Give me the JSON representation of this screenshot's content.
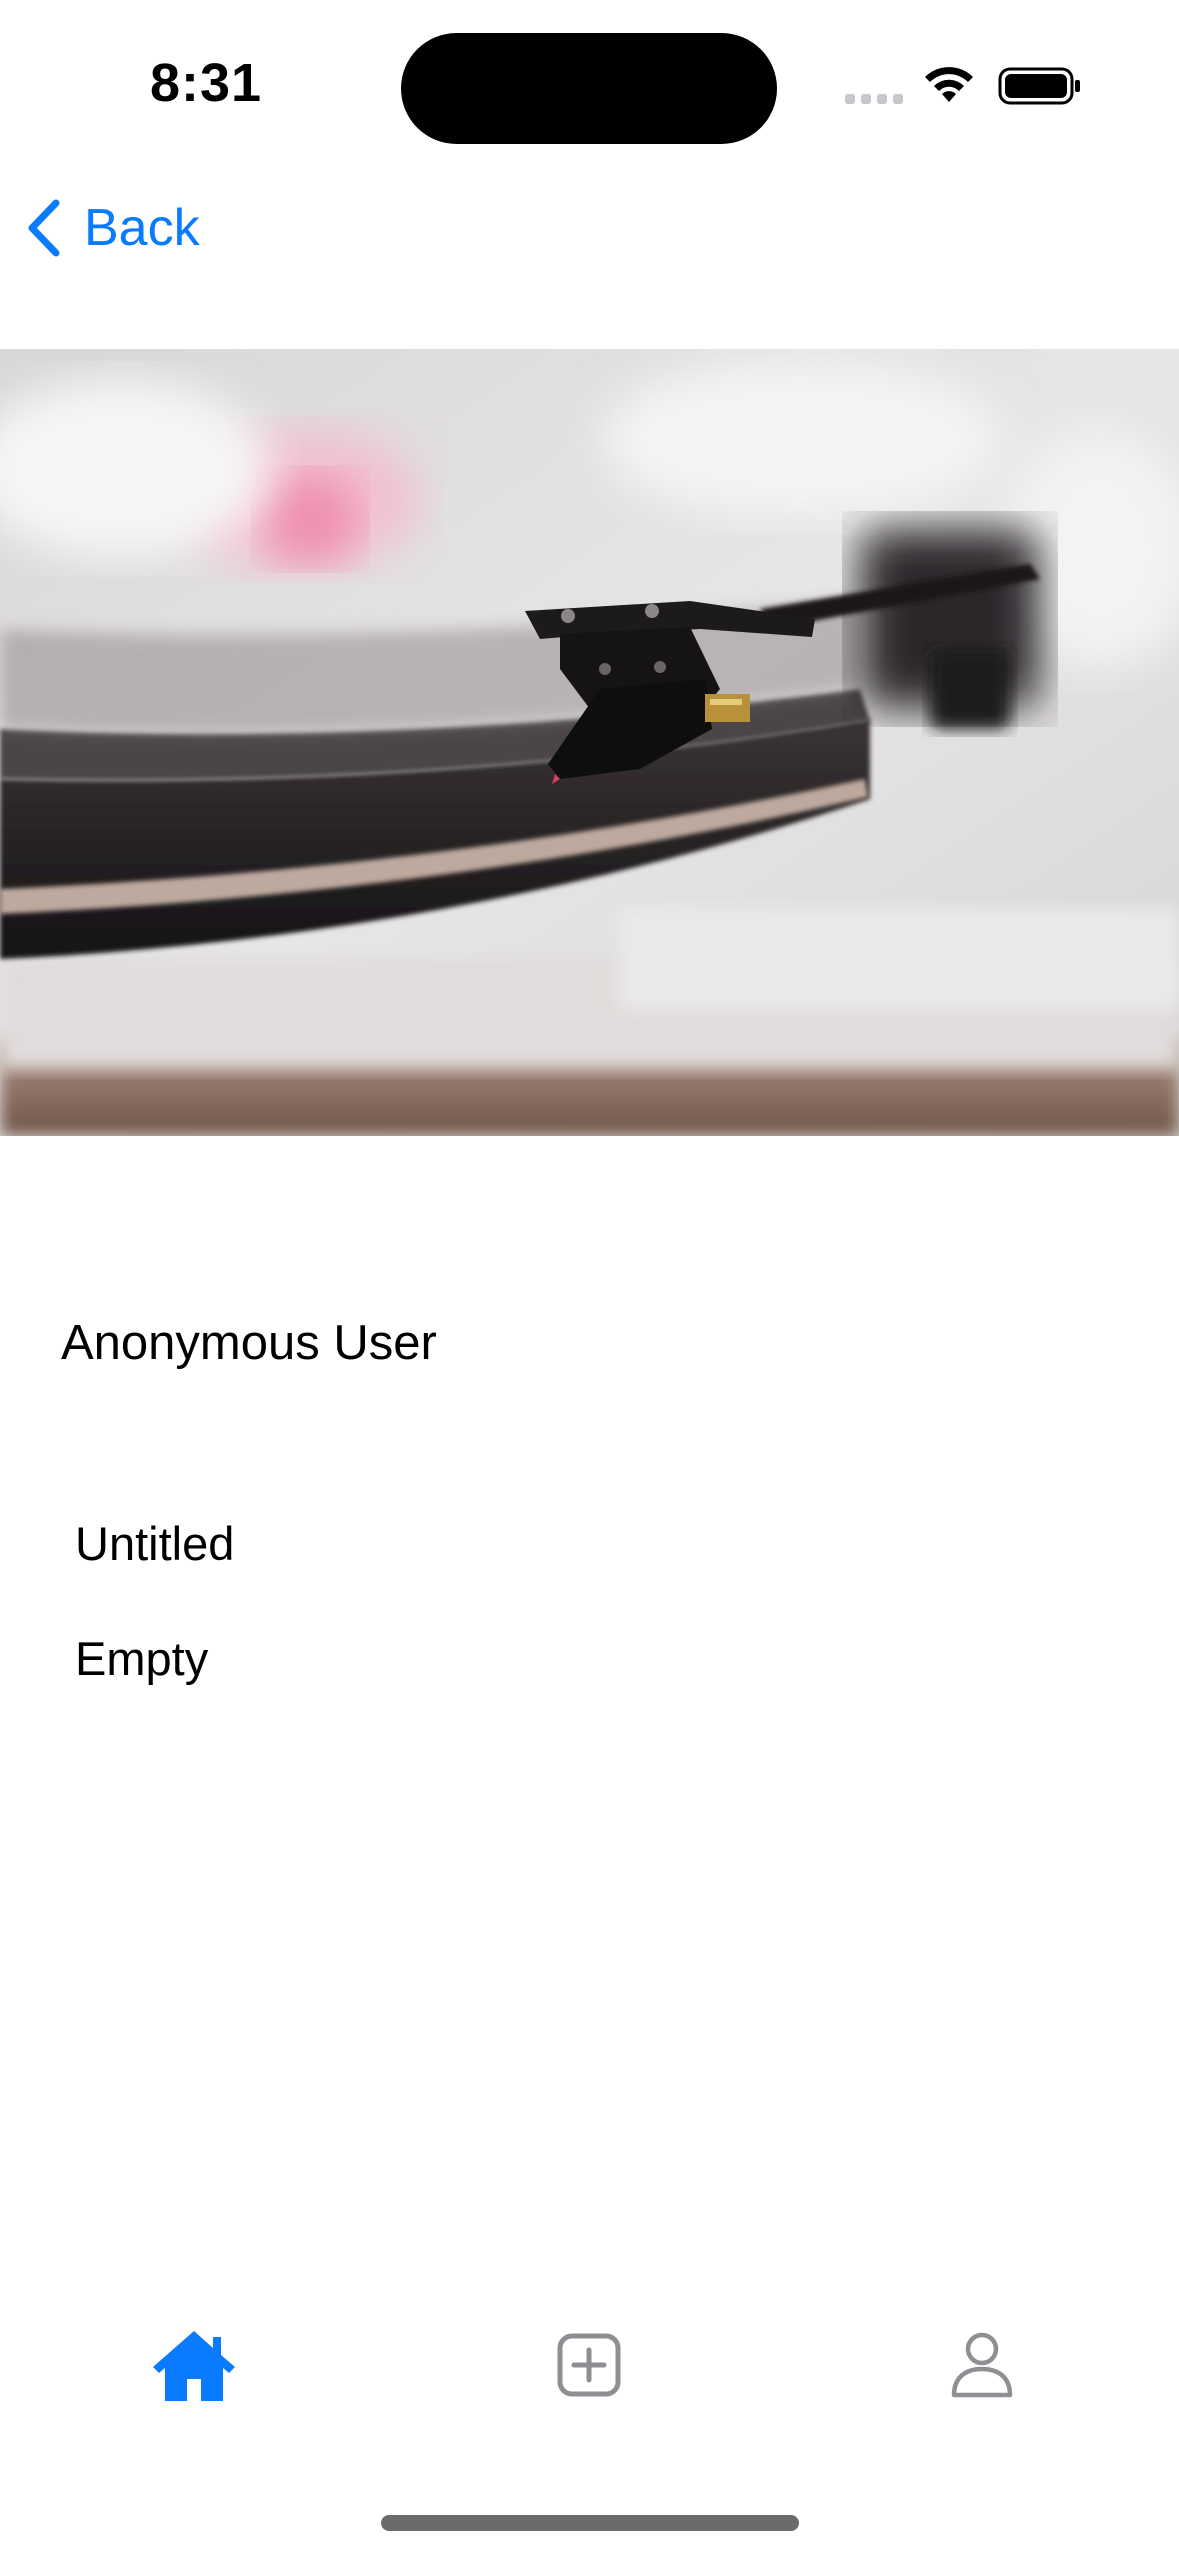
{
  "status_bar": {
    "time": "8:31"
  },
  "nav": {
    "back_label": "Back"
  },
  "profile": {
    "username": "Anonymous User"
  },
  "item": {
    "title": "Untitled",
    "description": "Empty"
  },
  "tab_bar": {
    "tabs": [
      {
        "icon": "home-icon",
        "active": true
      },
      {
        "icon": "plus-square-icon",
        "active": false
      },
      {
        "icon": "person-icon",
        "active": false
      }
    ]
  },
  "colors": {
    "accent": "#0a7aff",
    "inactive_icon": "#8e8e93"
  }
}
